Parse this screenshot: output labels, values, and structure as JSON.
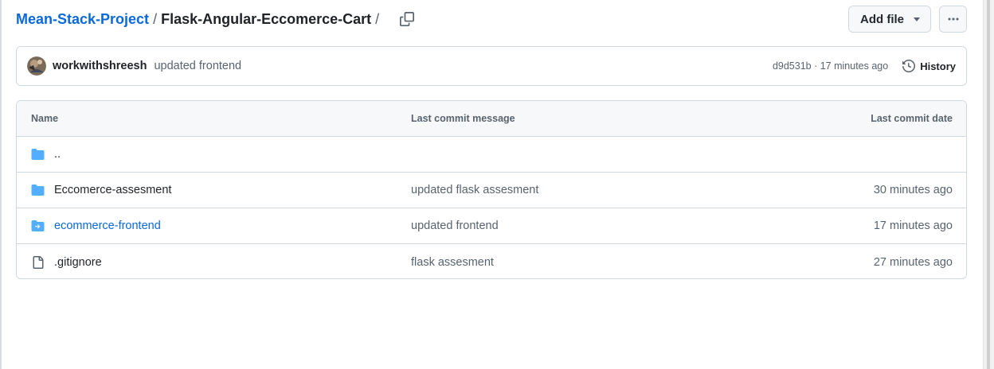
{
  "breadcrumb": {
    "repo": "Mean-Stack-Project",
    "separator": "/",
    "folder": "Flask-Angular-Eccomerce-Cart",
    "trailing_separator": "/"
  },
  "actions": {
    "add_file_label": "Add file",
    "more_label": "···"
  },
  "commit": {
    "author": "workwithshreesh",
    "message": "updated frontend",
    "meta": "d9d531b · 17 minutes ago",
    "history_label": "History"
  },
  "table": {
    "headers": {
      "name": "Name",
      "message": "Last commit message",
      "date": "Last commit date"
    },
    "parent_label": "..",
    "rows": [
      {
        "icon": "folder-icon",
        "name": "Eccomerce-assesment",
        "message": "updated flask assesment",
        "date": "30 minutes ago"
      },
      {
        "icon": "submodule-folder-icon",
        "name": "ecommerce-frontend",
        "message": "updated frontend",
        "date": "17 minutes ago"
      },
      {
        "icon": "file-icon",
        "name": ".gitignore",
        "message": "flask assesment",
        "date": "27 minutes ago"
      }
    ]
  },
  "colors": {
    "link": "#0969da",
    "folder": "#54aeff",
    "muted": "#59636e",
    "border": "#d1d9e0"
  }
}
